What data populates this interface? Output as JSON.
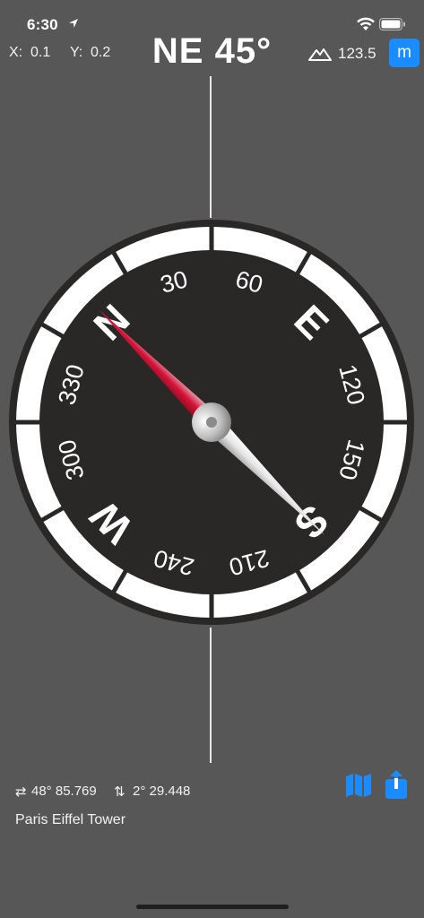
{
  "status_bar": {
    "time": "6:30"
  },
  "top_bar": {
    "x_label": "X:",
    "x_value": "0.1",
    "y_label": "Y:",
    "y_value": "0.2",
    "heading": "NE 45°",
    "altitude": "123.5",
    "unit_button": "m"
  },
  "compass": {
    "cardinals": {
      "north": "N",
      "east": "E",
      "south": "S",
      "west": "W"
    },
    "degree_labels": [
      "30",
      "60",
      "120",
      "150",
      "210",
      "240",
      "300",
      "330"
    ],
    "needle_heading_deg": 315,
    "colors": {
      "bezel": "#ffffff",
      "dial": "#2a2727",
      "needle_north": "#c8102e",
      "needle_south": "#d8d8d8"
    }
  },
  "location": {
    "lat_icon": "⇄",
    "lat_value": "48° 85.769",
    "lon_icon": "⇅",
    "lon_value": "2° 29.448",
    "place": "Paris Eiffel Tower"
  },
  "icons": {
    "status_location": "location-arrow-icon",
    "wifi": "wifi-icon",
    "battery": "battery-icon",
    "altitude": "mountain-icon",
    "map": "map-icon",
    "share": "share-icon"
  },
  "accent_color": "#1a8cff"
}
